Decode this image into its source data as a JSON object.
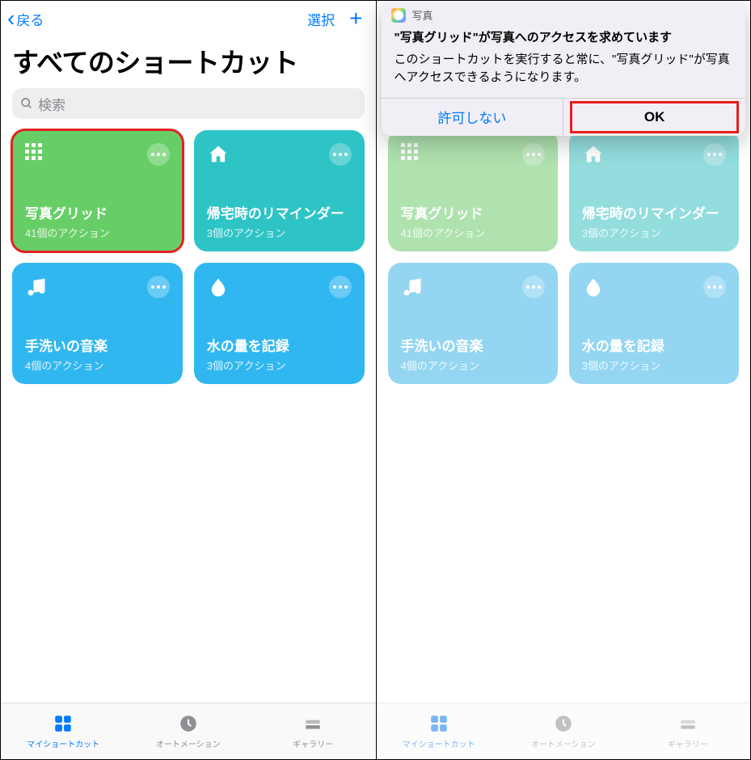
{
  "nav": {
    "back": "戻る",
    "select": "選択"
  },
  "title": "すべてのショートカット",
  "search": {
    "placeholder": "検索"
  },
  "shortcuts": [
    {
      "name": "写真グリッド",
      "sub": "41個のアクション"
    },
    {
      "name": "帰宅時のリマインダー",
      "sub": "3個のアクション"
    },
    {
      "name": "手洗いの音楽",
      "sub": "4個のアクション"
    },
    {
      "name": "水の量を記録",
      "sub": "3個のアクション"
    }
  ],
  "tabs": {
    "my": "マイショートカット",
    "auto": "オートメーション",
    "gallery": "ギャラリー"
  },
  "alert": {
    "app": "写真",
    "title": "\"写真グリッド\"が写真へのアクセスを求めています",
    "message": "このショートカットを実行すると常に、\"写真グリッド\"が写真へアクセスできるようになります。",
    "deny": "許可しない",
    "ok": "OK"
  }
}
